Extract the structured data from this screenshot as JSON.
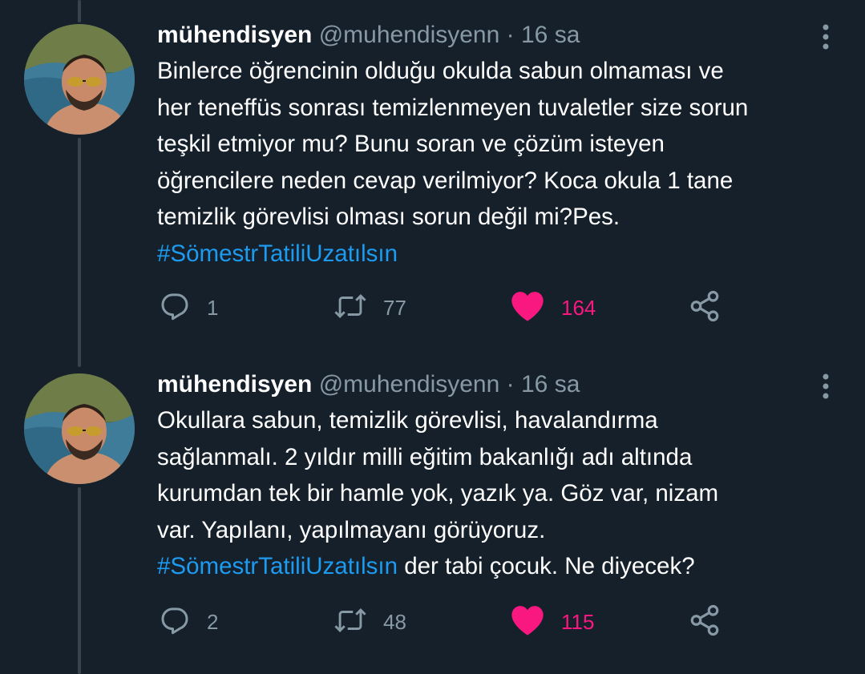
{
  "tweets": [
    {
      "name": "mühendisyen",
      "handle": "@muhendisyenn",
      "separator": "·",
      "time": "16 sa",
      "lines": [
        "Binlerce öğrencinin olduğu okulda sabun olmaması ve",
        "her teneffüs sonrası temizlenmeyen tuvaletler size sorun",
        "teşkil etmiyor mu? Bunu soran ve çözüm isteyen",
        "öğrencilere neden cevap verilmiyor? Koca okula 1 tane",
        "temizlik görevlisi olması sorun değil mi?Pes."
      ],
      "hashtag": "#SömestrTatiliUzatılsın",
      "hashtag_suffix": "",
      "replies": "1",
      "retweets": "77",
      "likes": "164"
    },
    {
      "name": "mühendisyen",
      "handle": "@muhendisyenn",
      "separator": "·",
      "time": "16 sa",
      "lines": [
        "Okullara sabun, temizlik görevlisi, havalandırma",
        "sağlanmalı. 2 yıldır milli eğitim bakanlığı adı altında",
        "kurumdan tek bir hamle yok, yazık ya. Göz var, nizam",
        "var. Yapılanı, yapılmayanı  görüyoruz."
      ],
      "hashtag": "#SömestrTatiliUzatılsın",
      "hashtag_suffix": " der tabi çocuk. Ne diyecek?",
      "replies": "2",
      "retweets": "48",
      "likes": "115"
    }
  ],
  "icons": {
    "reply": "reply-icon",
    "retweet": "retweet-icon",
    "like": "heart-icon",
    "share": "share-icon",
    "more": "more-options-icon"
  },
  "colors": {
    "background": "#15202b",
    "text": "#ffffff",
    "muted": "#8899a6",
    "link": "#1d9bf0",
    "like": "#f91880",
    "thread_line": "#38444d"
  }
}
